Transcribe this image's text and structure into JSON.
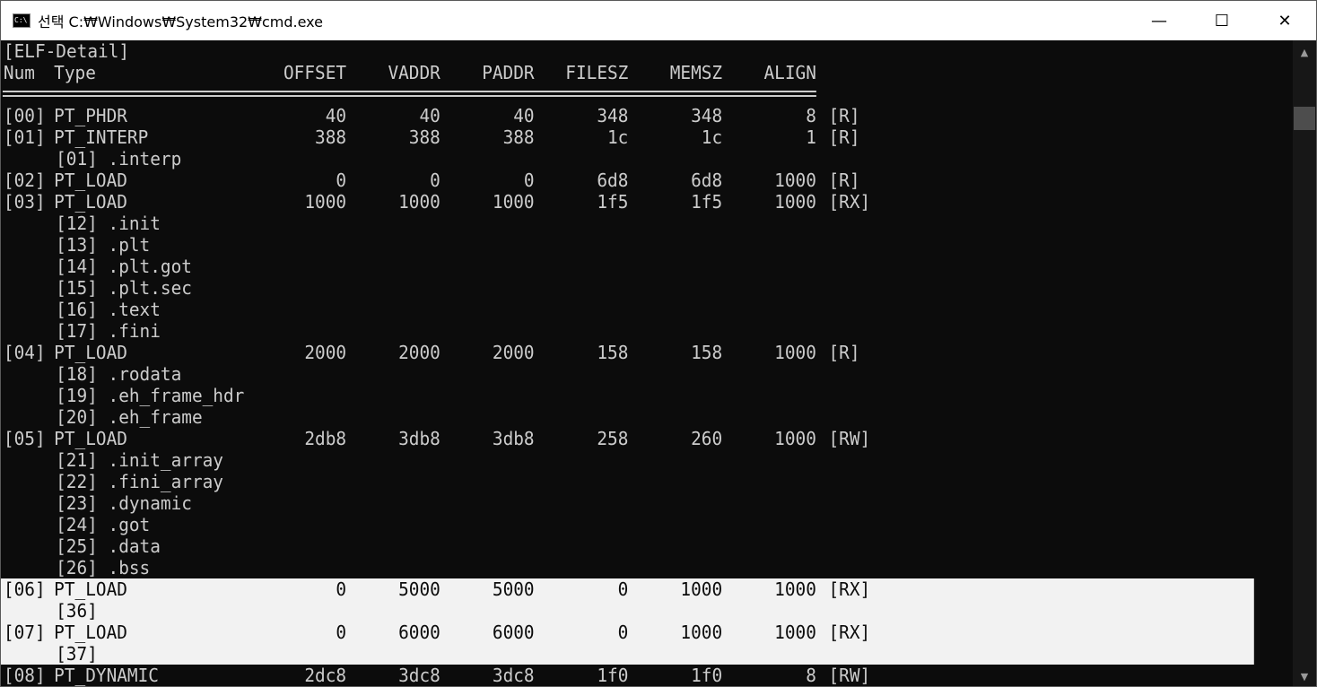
{
  "window": {
    "icon_text": "C:\\",
    "title": "선택 C:₩Windows₩System32₩cmd.exe",
    "minimize_glyph": "—",
    "maximize_glyph": "☐",
    "close_glyph": "✕",
    "scroll_up_glyph": "▲",
    "scroll_down_glyph": "▼"
  },
  "console": {
    "heading": "[ELF-Detail]",
    "columns": {
      "num": "Num",
      "type": "Type",
      "offset": "OFFSET",
      "vaddr": "VADDR",
      "paddr": "PADDR",
      "filesz": "FILESZ",
      "memsz": "MEMSZ",
      "align": "ALIGN"
    },
    "rows": [
      {
        "kind": "seg",
        "num": "[00]",
        "type": "PT_PHDR",
        "offset": "40",
        "vaddr": "40",
        "paddr": "40",
        "filesz": "348",
        "memsz": "348",
        "align": "8",
        "flags": "[R]"
      },
      {
        "kind": "seg",
        "num": "[01]",
        "type": "PT_INTERP",
        "offset": "388",
        "vaddr": "388",
        "paddr": "388",
        "filesz": "1c",
        "memsz": "1c",
        "align": "1",
        "flags": "[R]"
      },
      {
        "kind": "sec",
        "text": "[01] .interp"
      },
      {
        "kind": "seg",
        "num": "[02]",
        "type": "PT_LOAD",
        "offset": "0",
        "vaddr": "0",
        "paddr": "0",
        "filesz": "6d8",
        "memsz": "6d8",
        "align": "1000",
        "flags": "[R]"
      },
      {
        "kind": "seg",
        "num": "[03]",
        "type": "PT_LOAD",
        "offset": "1000",
        "vaddr": "1000",
        "paddr": "1000",
        "filesz": "1f5",
        "memsz": "1f5",
        "align": "1000",
        "flags": "[RX]"
      },
      {
        "kind": "sec",
        "text": "[12] .init"
      },
      {
        "kind": "sec",
        "text": "[13] .plt"
      },
      {
        "kind": "sec",
        "text": "[14] .plt.got"
      },
      {
        "kind": "sec",
        "text": "[15] .plt.sec"
      },
      {
        "kind": "sec",
        "text": "[16] .text"
      },
      {
        "kind": "sec",
        "text": "[17] .fini"
      },
      {
        "kind": "seg",
        "num": "[04]",
        "type": "PT_LOAD",
        "offset": "2000",
        "vaddr": "2000",
        "paddr": "2000",
        "filesz": "158",
        "memsz": "158",
        "align": "1000",
        "flags": "[R]"
      },
      {
        "kind": "sec",
        "text": "[18] .rodata"
      },
      {
        "kind": "sec",
        "text": "[19] .eh_frame_hdr"
      },
      {
        "kind": "sec",
        "text": "[20] .eh_frame"
      },
      {
        "kind": "seg",
        "num": "[05]",
        "type": "PT_LOAD",
        "offset": "2db8",
        "vaddr": "3db8",
        "paddr": "3db8",
        "filesz": "258",
        "memsz": "260",
        "align": "1000",
        "flags": "[RW]"
      },
      {
        "kind": "sec",
        "text": "[21] .init_array"
      },
      {
        "kind": "sec",
        "text": "[22] .fini_array"
      },
      {
        "kind": "sec",
        "text": "[23] .dynamic"
      },
      {
        "kind": "sec",
        "text": "[24] .got"
      },
      {
        "kind": "sec",
        "text": "[25] .data"
      },
      {
        "kind": "sec",
        "text": "[26] .bss"
      },
      {
        "kind": "seg",
        "sel": true,
        "num": "[06]",
        "type": "PT_LOAD",
        "offset": "0",
        "vaddr": "5000",
        "paddr": "5000",
        "filesz": "0",
        "memsz": "1000",
        "align": "1000",
        "flags": "[RX]"
      },
      {
        "kind": "sec",
        "sel": true,
        "text": "[36]"
      },
      {
        "kind": "seg",
        "sel": true,
        "num": "[07]",
        "type": "PT_LOAD",
        "offset": "0",
        "vaddr": "6000",
        "paddr": "6000",
        "filesz": "0",
        "memsz": "1000",
        "align": "1000",
        "flags": "[RX]"
      },
      {
        "kind": "sec",
        "sel": true,
        "text": "[37]"
      },
      {
        "kind": "seg",
        "num": "[08]",
        "type": "PT_DYNAMIC",
        "offset": "2dc8",
        "vaddr": "3dc8",
        "paddr": "3dc8",
        "filesz": "1f0",
        "memsz": "1f0",
        "align": "8",
        "flags": "[RW]"
      }
    ]
  },
  "colors": {
    "console_bg": "#0c0c0c",
    "console_fg": "#cccccc",
    "selection_bg": "#f2f2f2",
    "selection_fg": "#0c0c0c"
  }
}
